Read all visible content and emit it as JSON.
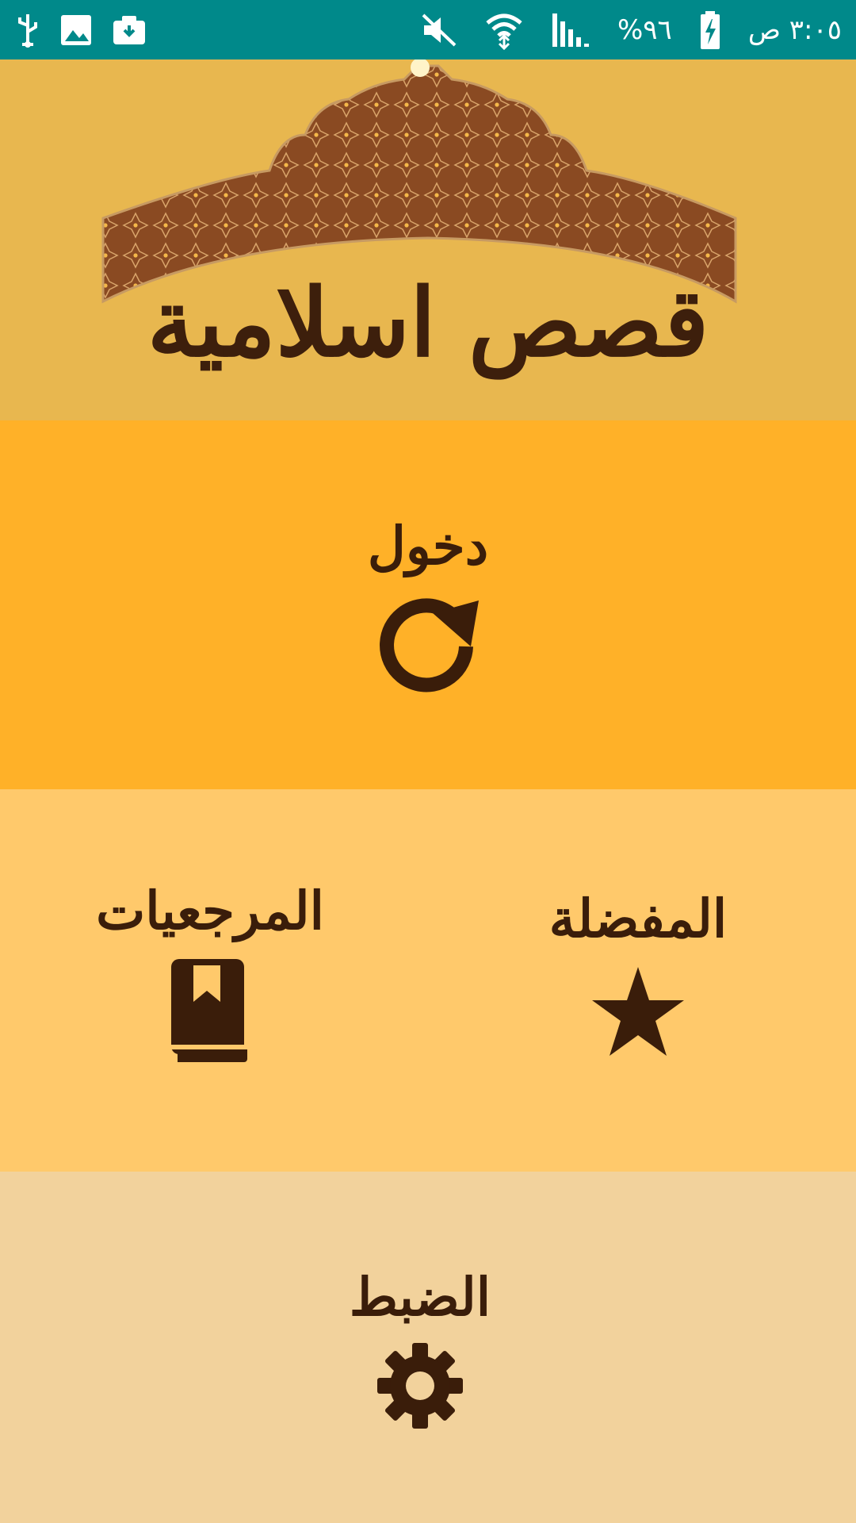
{
  "status_bar": {
    "time": "٣:٠٥ ص",
    "battery": "%٩٦",
    "icons": [
      "mute-icon",
      "wifi-icon",
      "signal-icon",
      "battery-icon",
      "usb-icon",
      "gallery-icon",
      "screenshot-icon"
    ]
  },
  "header": {
    "title": "قصص اسلامية"
  },
  "menu": {
    "enter_label": "دخول",
    "favorites_label": "المفضلة",
    "references_label": "المرجعيات",
    "settings_label": "الضبط"
  },
  "colors": {
    "status_bar": "#00898a",
    "header_bg": "#e8b74f",
    "enter_bg": "#ffb128",
    "middle_bg": "#ffc96b",
    "settings_bg": "#f2d29c",
    "text_brown": "#3a1d0a"
  }
}
